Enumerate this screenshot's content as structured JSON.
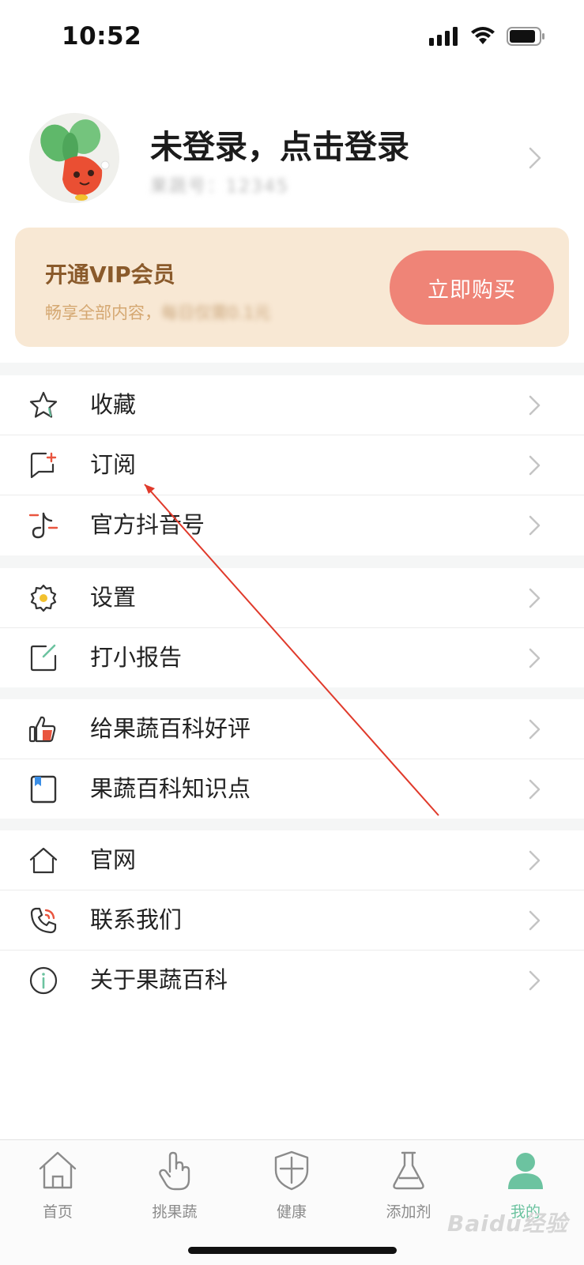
{
  "status_bar": {
    "time": "10:52"
  },
  "profile": {
    "name": "未登录，点击登录",
    "subtitle": "果蔬号：12345",
    "avatar_icon": "radish-mascot-avatar"
  },
  "vip": {
    "title": "开通VIP会员",
    "desc_prefix": "畅享全部内容，",
    "desc_blurred": "每日仅需0.1元",
    "button_label": "立即购买",
    "card_color": "#f8e8d4",
    "button_color": "#ef8477"
  },
  "menu_groups": [
    {
      "items": [
        {
          "label": "收藏",
          "icon": "star-icon"
        },
        {
          "label": "订阅",
          "icon": "subscribe-bookmark-icon"
        },
        {
          "label": "官方抖音号",
          "icon": "tiktok-icon"
        }
      ]
    },
    {
      "items": [
        {
          "label": "设置",
          "icon": "gear-icon"
        },
        {
          "label": "打小报告",
          "icon": "edit-report-icon"
        }
      ]
    },
    {
      "items": [
        {
          "label": "给果蔬百科好评",
          "icon": "thumbs-up-icon"
        },
        {
          "label": "果蔬百科知识点",
          "icon": "bookmark-book-icon"
        }
      ]
    },
    {
      "items": [
        {
          "label": "官网",
          "icon": "home-outline-icon"
        },
        {
          "label": "联系我们",
          "icon": "phone-icon"
        },
        {
          "label": "关于果蔬百科",
          "icon": "info-icon"
        }
      ]
    }
  ],
  "tabs": [
    {
      "label": "首页",
      "icon": "home-icon",
      "active": false
    },
    {
      "label": "挑果蔬",
      "icon": "hand-pointer-icon",
      "active": false
    },
    {
      "label": "健康",
      "icon": "shield-icon",
      "active": false
    },
    {
      "label": "添加剂",
      "icon": "flask-icon",
      "active": false
    },
    {
      "label": "我的",
      "icon": "person-icon",
      "active": true
    }
  ],
  "watermark": "Baidu经验",
  "accent_color": "#6cc3a0"
}
